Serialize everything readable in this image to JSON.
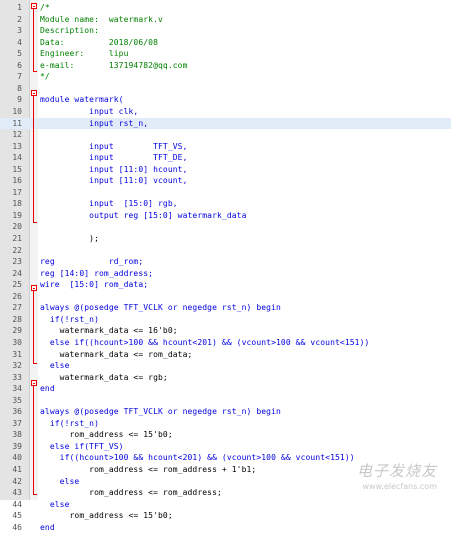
{
  "editor": {
    "lines": [
      {
        "n": "1",
        "t": "/*",
        "c": "cm"
      },
      {
        "n": "2",
        "t": "Module name:  watermark.v",
        "c": "cm"
      },
      {
        "n": "3",
        "t": "Description:",
        "c": "cm"
      },
      {
        "n": "4",
        "t": "Data:         2018/06/08",
        "c": "cm"
      },
      {
        "n": "5",
        "t": "Engineer:     lipu",
        "c": "cm"
      },
      {
        "n": "6",
        "t": "e-mail:       137194782@qq.com",
        "c": "cm"
      },
      {
        "n": "7",
        "t": "*/",
        "c": "cm"
      },
      {
        "n": "8",
        "t": ""
      },
      {
        "n": "9",
        "t": "module watermark(",
        "c": "kw"
      },
      {
        "n": "10",
        "t": "          input clk,",
        "c": "kw"
      },
      {
        "n": "11",
        "t": "          input rst_n,",
        "c": "kw",
        "hl": true
      },
      {
        "n": "12",
        "t": ""
      },
      {
        "n": "13",
        "t": "          input        TFT_VS,",
        "c": "kw"
      },
      {
        "n": "14",
        "t": "          input        TFT_DE,",
        "c": "kw"
      },
      {
        "n": "15",
        "t": "          input [11:0] hcount,",
        "c": "kw"
      },
      {
        "n": "16",
        "t": "          input [11:0] vcount,",
        "c": "kw"
      },
      {
        "n": "17",
        "t": ""
      },
      {
        "n": "18",
        "t": "          input  [15:0] rgb,",
        "c": "kw"
      },
      {
        "n": "19",
        "t": "          output reg [15:0] watermark_data",
        "c": "kw"
      },
      {
        "n": "20",
        "t": ""
      },
      {
        "n": "21",
        "t": "          );"
      },
      {
        "n": "22",
        "t": ""
      },
      {
        "n": "23",
        "t": "reg           rd_rom;",
        "c": "kw"
      },
      {
        "n": "24",
        "t": "reg [14:0] rom_address;",
        "c": "kw"
      },
      {
        "n": "25",
        "t": "wire  [15:0] rom_data;",
        "c": "kw"
      },
      {
        "n": "26",
        "t": ""
      },
      {
        "n": "27",
        "t": "always @(posedge TFT_VCLK or negedge rst_n) begin",
        "c": "kw"
      },
      {
        "n": "28",
        "t": "  if(!rst_n)",
        "c": "kw"
      },
      {
        "n": "29",
        "t": "    watermark_data <= 16'b0;"
      },
      {
        "n": "30",
        "t": "  else if((hcount>100 && hcount<201) && (vcount>100 && vcount<151))",
        "c": "kw"
      },
      {
        "n": "31",
        "t": "    watermark_data <= rom_data;"
      },
      {
        "n": "32",
        "t": "  else",
        "c": "kw"
      },
      {
        "n": "33",
        "t": "    watermark_data <= rgb;"
      },
      {
        "n": "34",
        "t": "end",
        "c": "kw"
      },
      {
        "n": "35",
        "t": ""
      },
      {
        "n": "36",
        "t": "always @(posedge TFT_VCLK or negedge rst_n) begin",
        "c": "kw"
      },
      {
        "n": "37",
        "t": "  if(!rst_n)",
        "c": "kw"
      },
      {
        "n": "38",
        "t": "      rom_address <= 15'b0;"
      },
      {
        "n": "39",
        "t": "  else if(TFT_VS)",
        "c": "kw"
      },
      {
        "n": "40",
        "t": "    if((hcount>100 && hcount<201) && (vcount>100 && vcount<151))",
        "c": "kw"
      },
      {
        "n": "41",
        "t": "          rom_address <= rom_address + 1'b1;"
      },
      {
        "n": "42",
        "t": "    else",
        "c": "kw"
      },
      {
        "n": "43",
        "t": "          rom_address <= rom_address;"
      },
      {
        "n": "44",
        "t": "  else",
        "c": "kw"
      },
      {
        "n": "45",
        "t": "      rom_address <= 15'b0;"
      },
      {
        "n": "46",
        "t": "end",
        "c": "kw"
      }
    ]
  },
  "watermark": {
    "main": "电子发烧友",
    "sub": "www.elecfans.com"
  }
}
